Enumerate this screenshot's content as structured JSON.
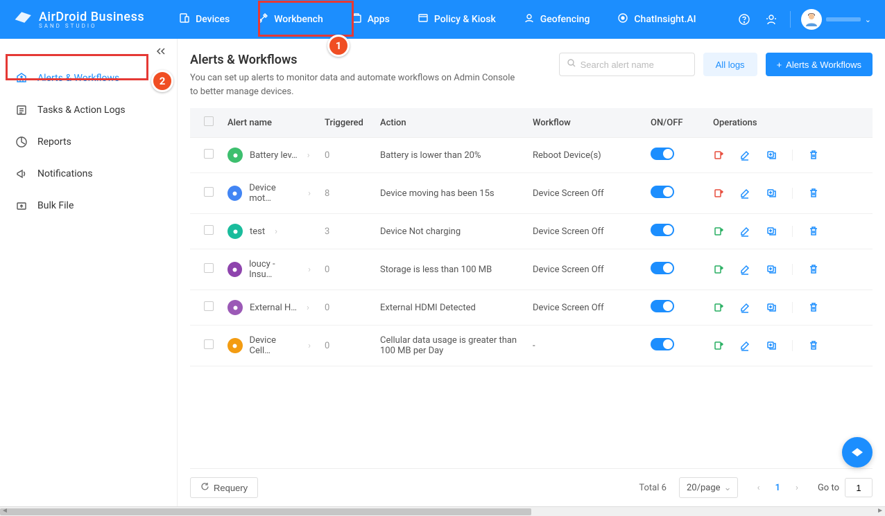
{
  "brand": {
    "name": "AirDroid Business",
    "sub": "SAND STUDIO"
  },
  "nav": {
    "items": [
      {
        "label": "Devices",
        "icon": "devices"
      },
      {
        "label": "Workbench",
        "icon": "workbench"
      },
      {
        "label": "Apps",
        "icon": "apps"
      },
      {
        "label": "Policy & Kiosk",
        "icon": "policy"
      },
      {
        "label": "Geofencing",
        "icon": "geofencing"
      },
      {
        "label": "ChatInsight.AI",
        "icon": "chat"
      }
    ]
  },
  "sidebar": {
    "items": [
      {
        "label": "Alerts & Workflows",
        "active": true
      },
      {
        "label": "Tasks & Action Logs"
      },
      {
        "label": "Reports"
      },
      {
        "label": "Notifications"
      },
      {
        "label": "Bulk File"
      }
    ]
  },
  "page": {
    "title": "Alerts & Workflows",
    "description": "You can set up alerts to monitor data and automate workflows on Admin Console to better manage devices.",
    "search_placeholder": "Search alert name",
    "all_logs": "All logs",
    "add_button": "Alerts & Workflows"
  },
  "table": {
    "headers": {
      "alert_name": "Alert name",
      "triggered": "Triggered",
      "action": "Action",
      "workflow": "Workflow",
      "onoff": "ON/OFF",
      "operations": "Operations"
    },
    "rows": [
      {
        "name": "Battery lev…",
        "triggered": "0",
        "action": "Battery is lower than 20%",
        "workflow": "Reboot Device(s)",
        "on": true,
        "iconClass": "ico-green",
        "opIconColor": "#e74c3c"
      },
      {
        "name": "Device mot…",
        "triggered": "8",
        "action": "Device moving has been 15s",
        "workflow": "Device Screen Off",
        "on": true,
        "iconClass": "ico-blue",
        "opIconColor": "#e74c3c"
      },
      {
        "name": "test",
        "triggered": "3",
        "action": "Device Not charging",
        "workflow": "Device Screen Off",
        "on": true,
        "iconClass": "ico-teal",
        "opIconColor": "#27ae60"
      },
      {
        "name": "loucy - Insu…",
        "triggered": "0",
        "action": "Storage is less than 100 MB",
        "workflow": "Device Screen Off",
        "on": true,
        "iconClass": "ico-purple",
        "opIconColor": "#27ae60"
      },
      {
        "name": "External H…",
        "triggered": "0",
        "action": "External HDMI Detected",
        "workflow": "Device Screen Off",
        "on": true,
        "iconClass": "ico-violet",
        "opIconColor": "#27ae60"
      },
      {
        "name": "Device Cell…",
        "triggered": "0",
        "action": "Cellular data usage is greater than 100 MB per Day",
        "workflow": "-",
        "on": true,
        "iconClass": "ico-orange",
        "opIconColor": "#27ae60"
      }
    ]
  },
  "footer": {
    "requery": "Requery",
    "total_label": "Total",
    "total_count": "6",
    "page_size": "20/page",
    "current_page": "1",
    "goto_label": "Go to",
    "goto_value": "1"
  },
  "annotations": {
    "one": "1",
    "two": "2"
  }
}
